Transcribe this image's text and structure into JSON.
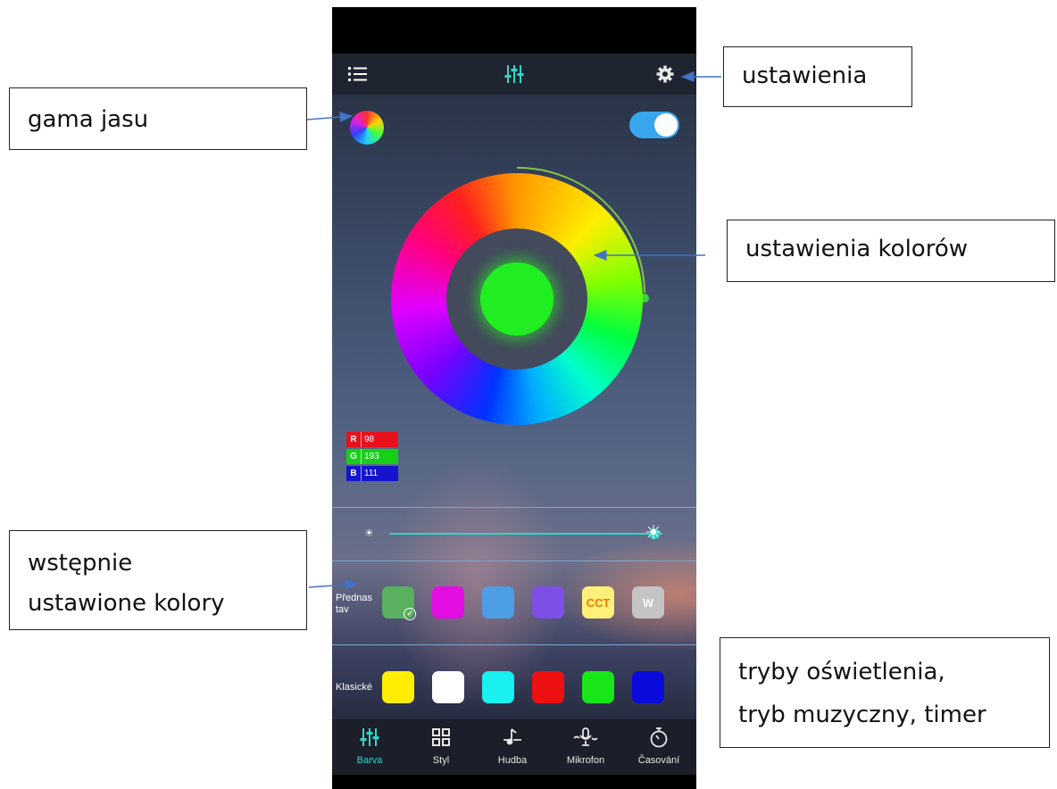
{
  "annotations": {
    "gamma": "gama jasu",
    "settings": "ustawienia",
    "color_settings": "ustawienia kolorów",
    "preset_line1": "wstępnie",
    "preset_line2": "ustawione kolory",
    "modes_line1": "tryby oświetlenia,",
    "modes_line2": "tryb muzyczny, timer"
  },
  "app": {
    "menu_icon": "list-icon",
    "header_icon": "equalizer-sliders-icon",
    "settings_icon": "gear-icon",
    "gamma_icon": "color-gamut-icon",
    "power_toggle": "on",
    "color_wheel": {
      "indicator_color": "#21ee21",
      "accent": "#8ed14a"
    },
    "rgb": [
      {
        "key": "R",
        "value": "98",
        "color": "#e8101c"
      },
      {
        "key": "G",
        "value": "193",
        "color": "#18cf18"
      },
      {
        "key": "B",
        "value": "111",
        "color": "#1414cc"
      }
    ],
    "brightness": {
      "level": 0.97,
      "low_icon": "sun-small-icon",
      "high_icon": "sun-large-icon"
    },
    "presets": {
      "label": "Přednas\ntav",
      "swatches": [
        {
          "color": "#59b05e",
          "text": "",
          "selected": true
        },
        {
          "color": "#e40de4",
          "text": ""
        },
        {
          "color": "#4d9ee4",
          "text": ""
        },
        {
          "color": "#7c4fe6",
          "text": ""
        },
        {
          "color": "#fff07a",
          "text": "CCT",
          "text_color": "#ef7a00"
        },
        {
          "color": "#c4c4c4",
          "text": "W",
          "text_color": "#ffffff"
        }
      ]
    },
    "classic": {
      "label": "Klasické",
      "swatches": [
        "#ffee00",
        "#ffffff",
        "#19f0f0",
        "#ee1010",
        "#19e619",
        "#0a0adc"
      ]
    },
    "nav": [
      {
        "label": "Barva",
        "icon": "equalizer-sliders-icon",
        "active": true
      },
      {
        "label": "Styl",
        "icon": "grid-icon",
        "active": false
      },
      {
        "label": "Hudba",
        "icon": "music-note-icon",
        "active": false
      },
      {
        "label": "Mikrofon",
        "icon": "microphone-icon",
        "active": false
      },
      {
        "label": "Časování",
        "icon": "stopwatch-icon",
        "active": false
      }
    ],
    "accent": "#2fd6c8"
  }
}
